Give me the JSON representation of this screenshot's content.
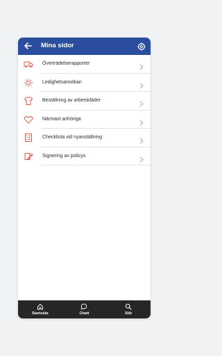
{
  "header": {
    "title": "Mina sidor",
    "back_icon": "arrow-left-icon",
    "settings_icon": "gear-icon",
    "bg": "#2a4d9d"
  },
  "menu": {
    "items": [
      {
        "label": "Överträdelserapporter",
        "icon": "truck-icon"
      },
      {
        "label": "Ledighetsansökan",
        "icon": "sun-icon"
      },
      {
        "label": "Beställning av arbetskläder",
        "icon": "shirt-icon"
      },
      {
        "label": "Närmast anhöriga",
        "icon": "heart-icon"
      },
      {
        "label": "Checklista vid nyanställning",
        "icon": "checklist-icon"
      },
      {
        "label": "Signering av policys",
        "icon": "signature-icon"
      }
    ],
    "icon_color": "#e05a4a"
  },
  "tabbar": {
    "tabs": [
      {
        "label": "Startsida",
        "icon": "home-icon"
      },
      {
        "label": "Chatt",
        "icon": "chat-icon"
      },
      {
        "label": "Sök",
        "icon": "search-icon"
      }
    ],
    "bg": "#262626"
  }
}
